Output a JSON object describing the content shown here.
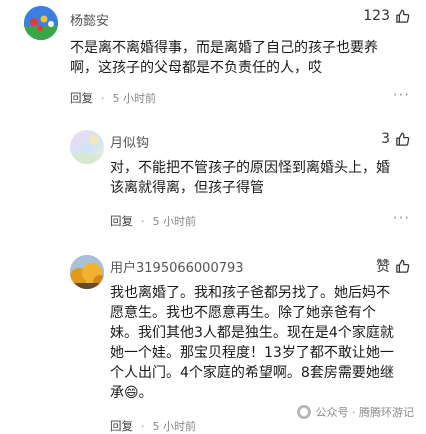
{
  "comments": [
    {
      "username": "杨懿安",
      "like_count": "123",
      "lines": [
        "不是离不离婚得事，而是离婚了自己的孩子也要养",
        "啊，这孩子的父母都是不负责任的人，哎"
      ],
      "reply_label": "回复",
      "time": "5 小时前"
    },
    {
      "username": "月似钩",
      "like_count": "3",
      "lines": [
        "对，不能把不管孩子的原因怪到离婚头上，婚",
        "该离就得离，但孩子得管"
      ],
      "reply_label": "回复",
      "time": "5 小时前"
    },
    {
      "username": "用户3195066000793",
      "like_label": "赞",
      "lines": [
        "我也离婚了。我和孩子爸都另找了。她后妈不",
        "愿意生。我也不愿意再生。除了她亲爸有个",
        "妹。我们其他3人都是独生。现在是4个家庭就",
        "她一个娃。那宝贝程度！13岁了都不敢让她一",
        "个人出门。4个家庭的希望啊。8套房需要她继",
        "承😄。"
      ],
      "reply_label": "回复",
      "time": "5 小时前"
    }
  ],
  "more_glyph": "···",
  "watermark": {
    "text": "公众号 · 腾腾环游记"
  }
}
